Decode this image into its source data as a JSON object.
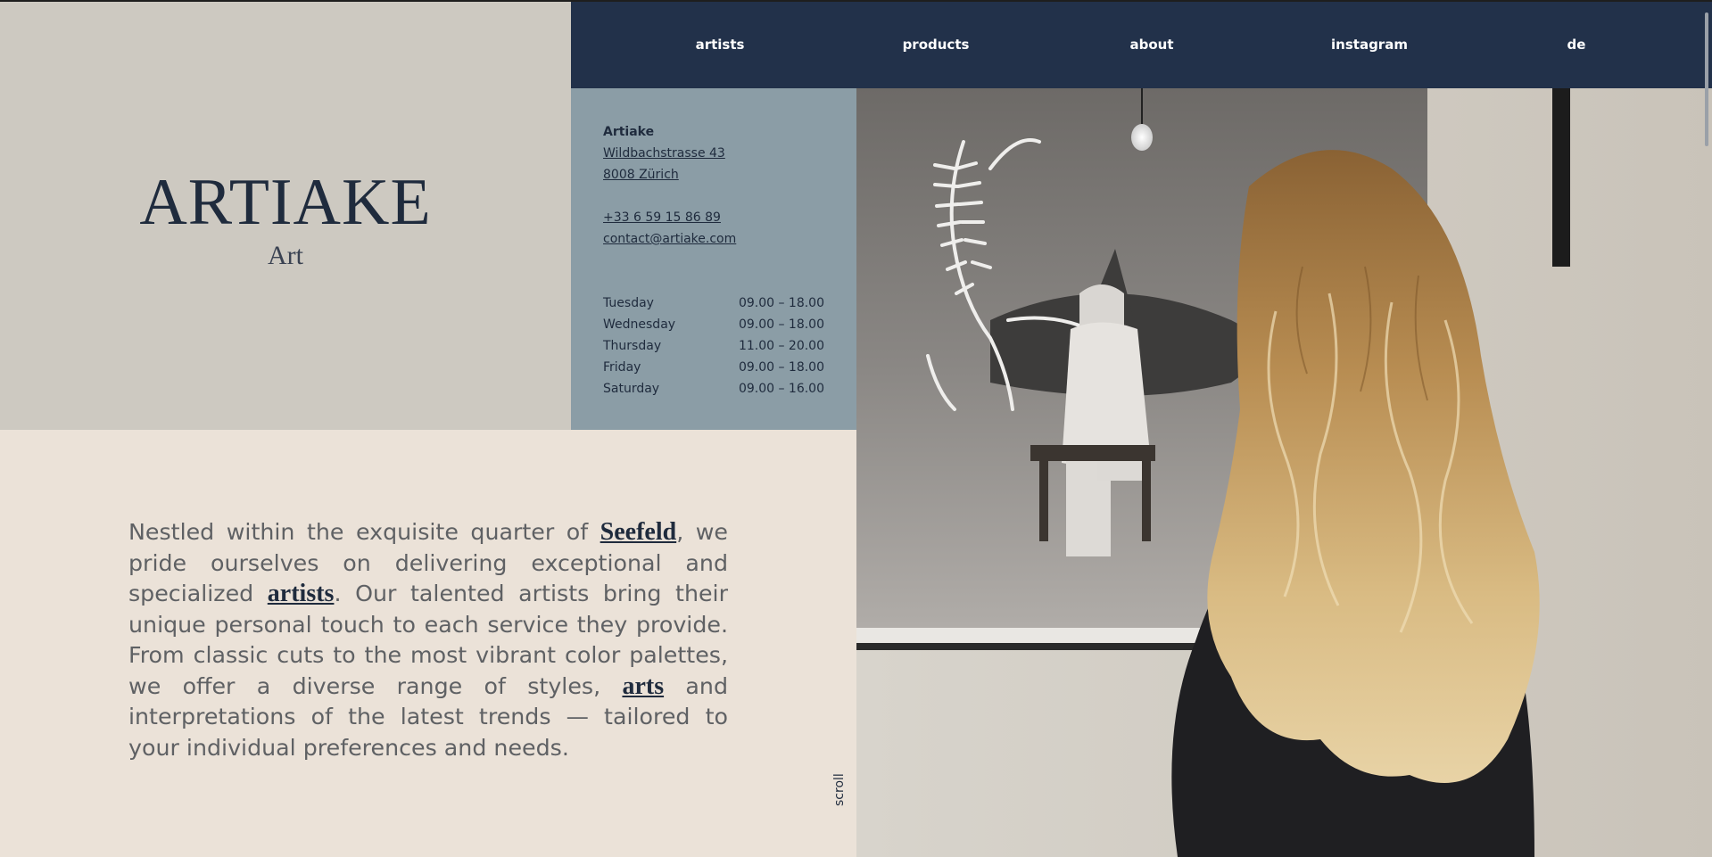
{
  "brand": {
    "name": "ARTIAKE",
    "subtitle": "Art"
  },
  "nav": {
    "items": [
      {
        "label": "artists"
      },
      {
        "label": "products"
      },
      {
        "label": "about"
      },
      {
        "label": "instagram"
      },
      {
        "label": "de"
      }
    ]
  },
  "contact": {
    "company": "Artiake",
    "street": "Wildbachstrasse 43",
    "city": "8008 Zürich",
    "phone": "+33 6 59 15 86 89",
    "email": "contact@artiake.com"
  },
  "hours": [
    {
      "day": "Tuesday",
      "time": "09.00 – 18.00"
    },
    {
      "day": "Wednesday",
      "time": "09.00 – 18.00"
    },
    {
      "day": "Thursday",
      "time": "11.00 – 20.00"
    },
    {
      "day": "Friday",
      "time": "09.00 – 18.00"
    },
    {
      "day": "Saturday",
      "time": "09.00 – 16.00"
    }
  ],
  "intro": {
    "t1": "Nestled within the exquisite quarter of ",
    "link1": "Seefeld",
    "t2": ", we pride ourselves on delivering exceptional and specialized ",
    "link2": "artists",
    "t3": ". Our talented artists bring their unique personal touch to each service they provide. From classic cuts to the most vibrant color palettes, we offer a diverse range of styles, ",
    "link3": "arts",
    "t4": " and interpretations of the latest trends — tailored to your individual preferences and needs."
  },
  "scroll_label": "scroll",
  "colors": {
    "navy": "#22314a",
    "logo_panel": "#cdc9c1",
    "info_panel": "#8b9da6",
    "page_background": "#ebe2d8"
  }
}
